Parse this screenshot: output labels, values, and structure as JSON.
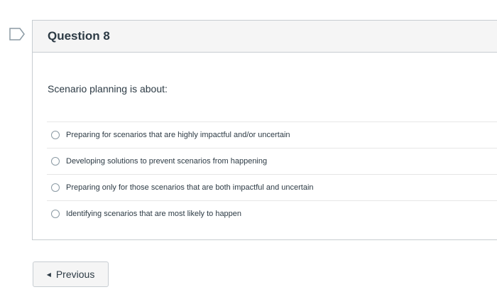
{
  "question": {
    "title": "Question 8",
    "prompt": "Scenario planning is about:",
    "answers": [
      {
        "label": "Preparing for scenarios that are highly impactful and/or uncertain"
      },
      {
        "label": "Developing solutions to prevent scenarios from happening"
      },
      {
        "label": "Preparing only for those scenarios that are both impactful and uncertain"
      },
      {
        "label": "Identifying scenarios that are most likely to happen"
      }
    ]
  },
  "navigation": {
    "previous_label": "Previous",
    "previous_icon": "triangle-left-icon"
  },
  "flag": {
    "icon": "bookmark-flag-icon",
    "color": "#8b9aa4"
  }
}
